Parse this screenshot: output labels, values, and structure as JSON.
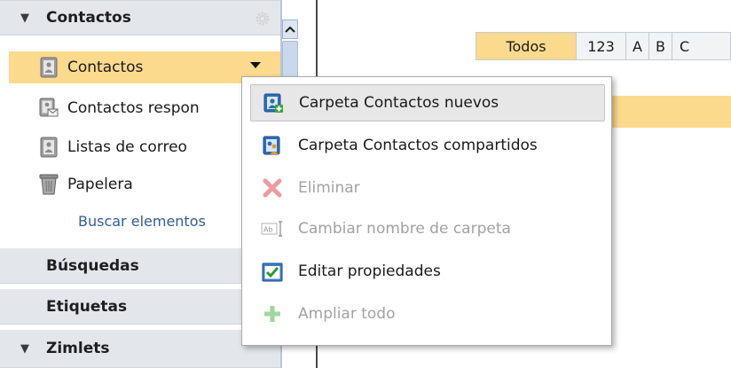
{
  "sidebar": {
    "contacts_header": "Contactos",
    "items": [
      {
        "label": "Contactos",
        "icon": "address-book-icon"
      },
      {
        "label": "Contactos respon",
        "icon": "emailed-contacts-icon"
      },
      {
        "label": "Listas de correo",
        "icon": "address-book-icon"
      },
      {
        "label": "Papelera",
        "icon": "trash-icon"
      }
    ],
    "search_link": "Buscar elementos",
    "searches_header": "Búsquedas",
    "tags_header": "Etiquetas",
    "zimlets_header": "Zimlets"
  },
  "alphabet": {
    "buttons": [
      "Todos",
      "123",
      "A",
      "B",
      "C"
    ]
  },
  "context_menu": {
    "items": [
      {
        "label": "Carpeta Contactos nuevos",
        "enabled": true,
        "icon": "new-contacts-folder-icon"
      },
      {
        "label": "Carpeta Contactos compartidos",
        "enabled": true,
        "icon": "shared-contacts-folder-icon"
      },
      {
        "label": "Eliminar",
        "enabled": false,
        "icon": "delete-x-icon"
      },
      {
        "label": "Cambiar nombre de carpeta",
        "enabled": false,
        "icon": "rename-icon"
      },
      {
        "label": "Editar propiedades",
        "enabled": true,
        "icon": "edit-properties-icon"
      },
      {
        "label": "Ampliar todo",
        "enabled": false,
        "icon": "expand-plus-icon"
      }
    ]
  },
  "colors": {
    "selection": "#fbd98d",
    "header_bg": "#e3e7ec",
    "link": "#2d5f9a",
    "disabled_text": "#a2a2a2"
  }
}
